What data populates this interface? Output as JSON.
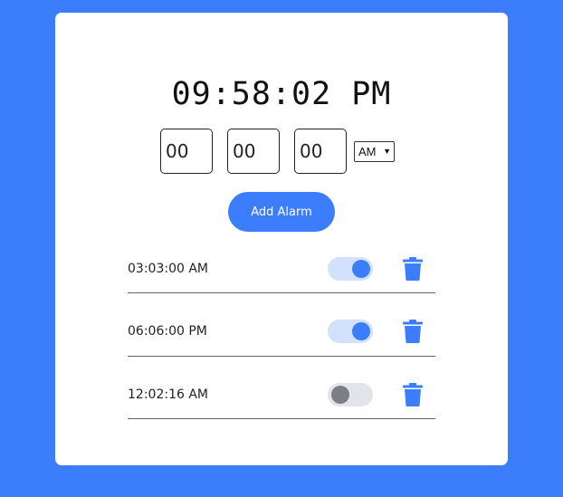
{
  "clock": {
    "time": "09:58:02 PM"
  },
  "inputs": {
    "hours_placeholder": "00",
    "minutes_placeholder": "00",
    "seconds_placeholder": "00",
    "ampm_selected": "AM"
  },
  "add_button": {
    "label": "Add Alarm"
  },
  "alarms": [
    {
      "time": "03:03:00 AM",
      "enabled": true
    },
    {
      "time": "06:06:00 PM",
      "enabled": true
    },
    {
      "time": "12:02:16 AM",
      "enabled": false
    }
  ],
  "colors": {
    "accent": "#3b7dfb",
    "toggle_on_track": "#d2e1fd",
    "toggle_off_track": "#e3e3ea",
    "toggle_off_knob": "#7d7d86"
  },
  "icons": {
    "delete": "trash-icon",
    "select": "chevron-down-icon"
  }
}
